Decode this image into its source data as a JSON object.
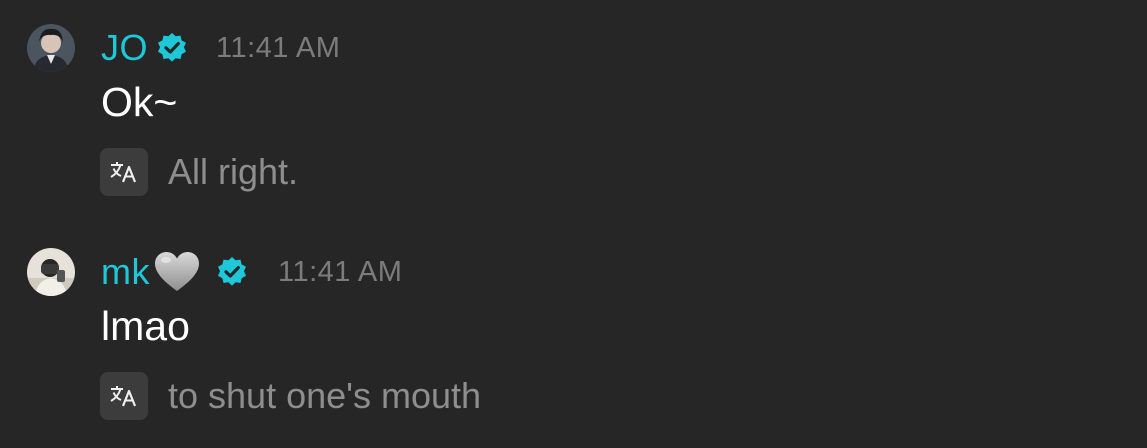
{
  "messages": [
    {
      "username": "JO",
      "verified": true,
      "timestamp": "11:41 AM",
      "text": "Ok~",
      "translation": "All right.",
      "avatar": "user-avatar"
    },
    {
      "username": "mk",
      "username_emoji": "grey-heart-icon",
      "verified": true,
      "timestamp": "11:41 AM",
      "text": "lmao",
      "translation": "to shut one's mouth",
      "avatar": "user-avatar"
    }
  ],
  "colors": {
    "background": "#262626",
    "username": "#1ec8d8",
    "verified_badge": "#1ec8d8",
    "timestamp": "#7c7c7c",
    "message_text": "#ffffff",
    "translation_text": "#8e8e8e",
    "translate_icon_bg": "#3c3c3c"
  }
}
